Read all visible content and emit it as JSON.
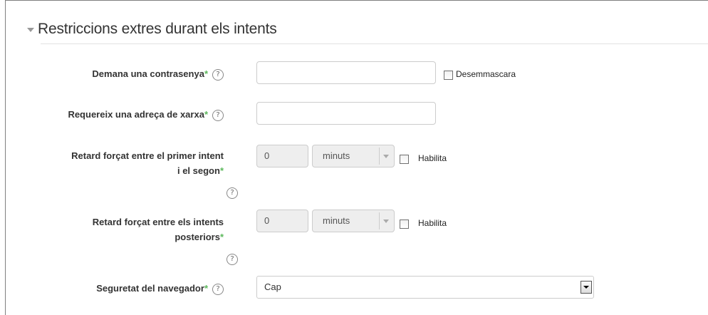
{
  "section": {
    "title": "Restriccions extres durant els intents"
  },
  "help_glyph": "?",
  "required_mark": "*",
  "fields": {
    "password": {
      "label": "Demana una contrasenya",
      "value": "",
      "unmask_label": "Desemmascara"
    },
    "network": {
      "label": "Requereix una adreça de xarxa",
      "value": ""
    },
    "delay1": {
      "label_line1": "Retard forçat entre el primer intent",
      "label_line2": "i el segon",
      "value": "0",
      "unit": "minuts",
      "enable_label": "Habilita"
    },
    "delay2": {
      "label_line1": "Retard forçat entre els intents",
      "label_line2": "posteriors",
      "value": "0",
      "unit": "minuts",
      "enable_label": "Habilita"
    },
    "browser": {
      "label": "Seguretat del navegador",
      "value": "Cap"
    }
  }
}
